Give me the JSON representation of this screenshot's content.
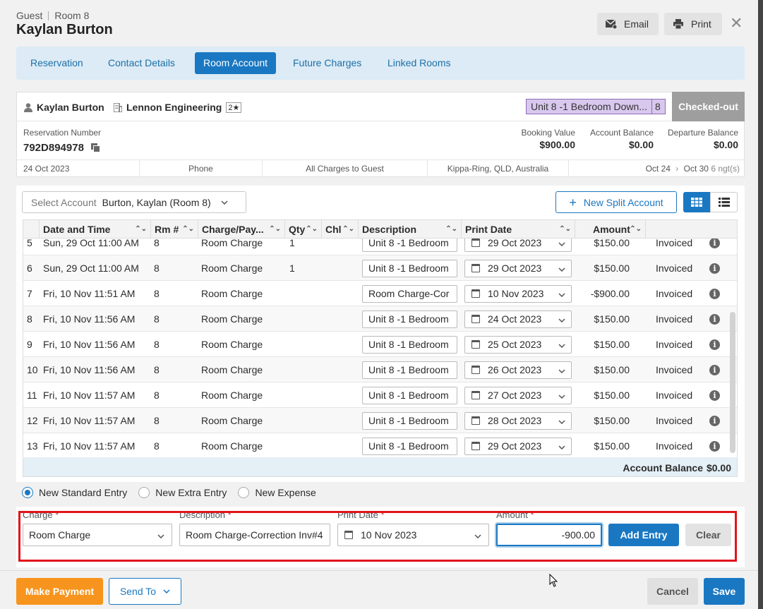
{
  "header": {
    "guest_label": "Guest",
    "room_label": "Room 8",
    "guest_name": "Kaylan Burton",
    "email_label": "Email",
    "print_label": "Print",
    "close_glyph": "✕"
  },
  "tabs": [
    {
      "label": "Reservation"
    },
    {
      "label": "Contact Details"
    },
    {
      "label": "Room Account",
      "active": true
    },
    {
      "label": "Future Charges"
    },
    {
      "label": "Linked Rooms"
    }
  ],
  "summary": {
    "guest": "Kaylan Burton",
    "company": "Lennon Engineering",
    "stars": "2★",
    "unit": "Unit 8 -1 Bedroom Down...",
    "unit_num": "8",
    "status": "Checked-out",
    "res_number_label": "Reservation Number",
    "res_number": "792D894978",
    "booking_value_label": "Booking Value",
    "booking_value": "$900.00",
    "account_balance_label": "Account Balance",
    "account_balance": "$0.00",
    "departure_balance_label": "Departure Balance",
    "departure_balance": "$0.00",
    "date_created": "24 Oct 2023",
    "source": "Phone",
    "billing": "All Charges to Guest",
    "location": "Kippa-Ring, QLD, Australia",
    "stay_from": "Oct 24",
    "stay_to": "Oct 30",
    "nights": "6 ngt(s)"
  },
  "account": {
    "select_label": "Select Account",
    "selected": "Burton, Kaylan (Room 8)",
    "new_split_label": "New Split Account",
    "columns": [
      "Date and Time",
      "Rm #",
      "Charge/Pay...",
      "Qty",
      "Chl",
      "Description",
      "Print Date",
      "Amount"
    ],
    "rows": [
      {
        "n": "5",
        "dt": "Sun, 29 Oct 11:00 AM",
        "rm": "8",
        "charge": "Room Charge",
        "qty": "1",
        "desc": "Unit 8 -1 Bedroom",
        "pdate": "29 Oct 2023",
        "amount": "$150.00",
        "status": "Invoiced"
      },
      {
        "n": "6",
        "dt": "Sun, 29 Oct 11:00 AM",
        "rm": "8",
        "charge": "Room Charge",
        "qty": "1",
        "desc": "Unit 8 -1 Bedroom",
        "pdate": "29 Oct 2023",
        "amount": "$150.00",
        "status": "Invoiced"
      },
      {
        "n": "7",
        "dt": "Fri, 10 Nov 11:51 AM",
        "rm": "8",
        "charge": "Room Charge",
        "qty": "",
        "desc": "Room Charge-Cor",
        "pdate": "10 Nov 2023",
        "amount": "-$900.00",
        "status": "Invoiced"
      },
      {
        "n": "8",
        "dt": "Fri, 10 Nov 11:56 AM",
        "rm": "8",
        "charge": "Room Charge",
        "qty": "",
        "desc": "Unit 8 -1 Bedroom",
        "pdate": "24 Oct 2023",
        "amount": "$150.00",
        "status": "Invoiced"
      },
      {
        "n": "9",
        "dt": "Fri, 10 Nov 11:56 AM",
        "rm": "8",
        "charge": "Room Charge",
        "qty": "",
        "desc": "Unit 8 -1 Bedroom",
        "pdate": "25 Oct 2023",
        "amount": "$150.00",
        "status": "Invoiced"
      },
      {
        "n": "10",
        "dt": "Fri, 10 Nov 11:56 AM",
        "rm": "8",
        "charge": "Room Charge",
        "qty": "",
        "desc": "Unit 8 -1 Bedroom",
        "pdate": "26 Oct 2023",
        "amount": "$150.00",
        "status": "Invoiced"
      },
      {
        "n": "11",
        "dt": "Fri, 10 Nov 11:57 AM",
        "rm": "8",
        "charge": "Room Charge",
        "qty": "",
        "desc": "Unit 8 -1 Bedroom",
        "pdate": "27 Oct 2023",
        "amount": "$150.00",
        "status": "Invoiced"
      },
      {
        "n": "12",
        "dt": "Fri, 10 Nov 11:57 AM",
        "rm": "8",
        "charge": "Room Charge",
        "qty": "",
        "desc": "Unit 8 -1 Bedroom",
        "pdate": "28 Oct 2023",
        "amount": "$150.00",
        "status": "Invoiced"
      },
      {
        "n": "13",
        "dt": "Fri, 10 Nov 11:57 AM",
        "rm": "8",
        "charge": "Room Charge",
        "qty": "",
        "desc": "Unit 8 -1 Bedroom",
        "pdate": "29 Oct 2023",
        "amount": "$150.00",
        "status": "Invoiced"
      }
    ],
    "balance_label": "Account Balance",
    "balance": "$0.00"
  },
  "entry_types": [
    {
      "label": "New Standard Entry",
      "selected": true
    },
    {
      "label": "New Extra Entry",
      "selected": false
    },
    {
      "label": "New Expense",
      "selected": false
    }
  ],
  "entry": {
    "charge_label": "Charge",
    "charge_value": "Room Charge",
    "description_label": "Description",
    "description_value": "Room Charge-Correction Inv#4",
    "print_date_label": "Print Date",
    "print_date_value": "10 Nov 2023",
    "amount_label": "Amount",
    "amount_value": "-900.00",
    "add_label": "Add Entry",
    "clear_label": "Clear"
  },
  "footer": {
    "make_payment": "Make Payment",
    "send_to": "Send To",
    "cancel": "Cancel",
    "save": "Save"
  },
  "colors": {
    "primary": "#1a78c2",
    "payment": "#f7941d",
    "highlight": "#e0151b",
    "unit_badge": "#d8c8ee",
    "checked_out": "#9e9e9e"
  }
}
